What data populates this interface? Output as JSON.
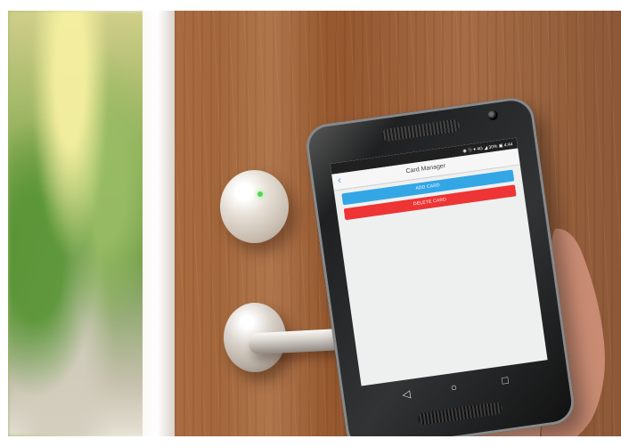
{
  "app": {
    "title": "Card Manager",
    "buttons": {
      "add_card": "ADD CARD",
      "delete_card": "DELETE CARD"
    }
  },
  "status_bar": {
    "text": "◉ ⓧ ▾ 4G ◢ 30% ▣ 4:44"
  },
  "icons": {
    "back": "back-icon",
    "nav_back": "back-nav-icon",
    "nav_home": "home-icon",
    "nav_recent": "recent-apps-icon"
  },
  "colors": {
    "add_button": "#33a6e6",
    "delete_button": "#ee3434",
    "lock_indicator": "#58d15a"
  }
}
